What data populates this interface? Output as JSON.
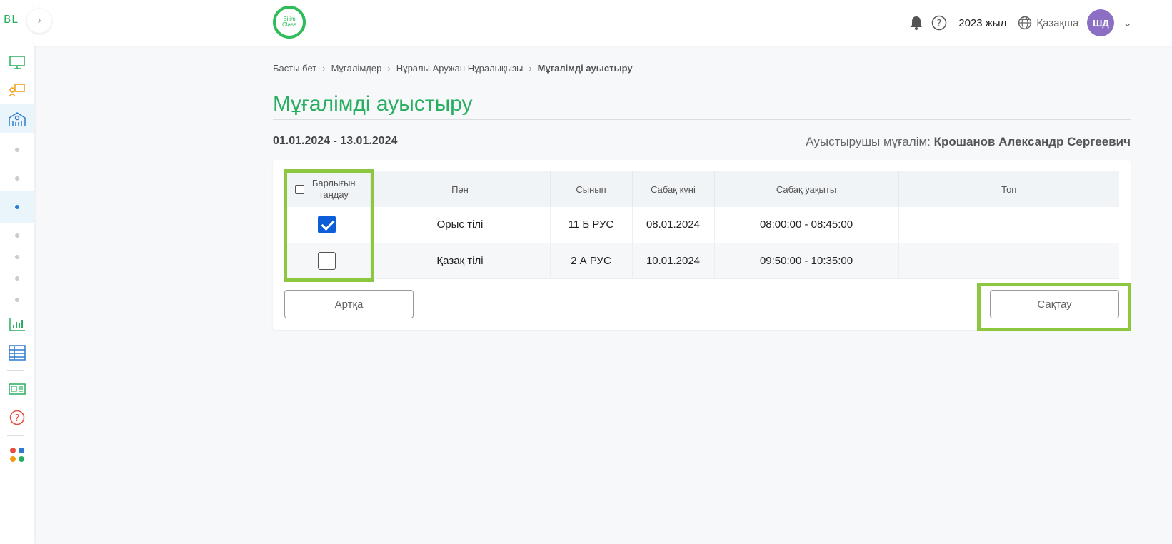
{
  "sidebar": {
    "logo": "BL",
    "toggle_icon": "chevron-right-icon",
    "colors": {
      "active_bg": "#eaf4fb",
      "active_dot": "#2d7bd1"
    }
  },
  "header": {
    "logo_line1": "Bilim",
    "logo_line2": "Class",
    "year": "2023 жыл",
    "language": "Қазақша",
    "avatar_initials": "ШД"
  },
  "breadcrumb": {
    "home": "Басты бет",
    "teachers": "Мұғалімдер",
    "teacher": "Нұралы Аружан Нұралықызы",
    "current": "Мұғалімді ауыстыру"
  },
  "page": {
    "title": "Мұғалімді ауыстыру",
    "date_range": "01.01.2024 - 13.01.2024",
    "substitute_label": "Ауыстырушы мұғалім:",
    "substitute_name": "Крошанов Александр Сергеевич"
  },
  "table": {
    "headers": {
      "select_all": "Барлығын таңдау",
      "subject": "Пән",
      "class": "Сынып",
      "lesson_date": "Сабақ күні",
      "lesson_time": "Сабақ уақыты",
      "group": "Топ"
    },
    "rows": [
      {
        "checked": true,
        "subject": "Орыс тілі",
        "class": "11 Б РУС",
        "date": "08.01.2024",
        "time": "08:00:00 - 08:45:00",
        "group": ""
      },
      {
        "checked": false,
        "subject": "Қазақ тілі",
        "class": "2 А РУС",
        "date": "10.01.2024",
        "time": "09:50:00 - 10:35:00",
        "group": ""
      }
    ]
  },
  "buttons": {
    "back": "Артқа",
    "save": "Сақтау"
  },
  "colors": {
    "accent_green": "#27ae60",
    "highlight": "#8dc63f",
    "checkbox_blue": "#0b5ed7",
    "avatar": "#8c6fc4"
  }
}
